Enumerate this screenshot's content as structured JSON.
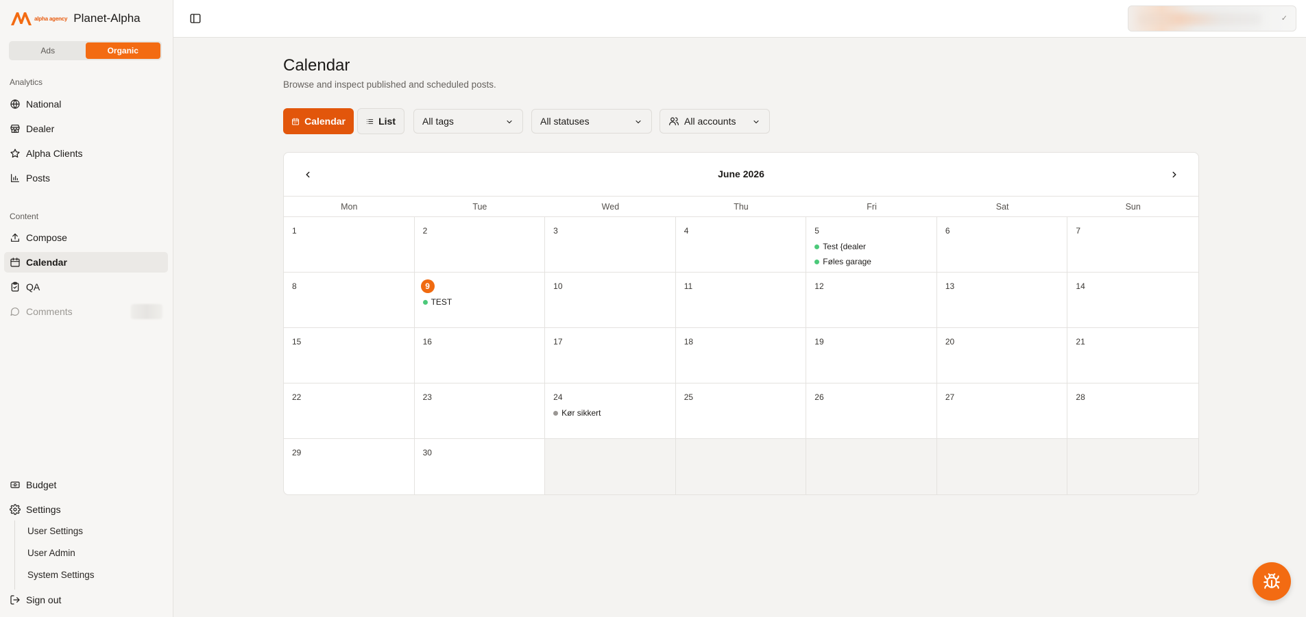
{
  "brand": {
    "agency_text": "alpha agency",
    "name": "Planet-Alpha",
    "accent": "#f36b12"
  },
  "mode": {
    "ads": "Ads",
    "organic": "Organic",
    "selected": "Organic"
  },
  "analytics": {
    "label": "Analytics",
    "items": [
      {
        "label": "National",
        "icon": "globe-icon"
      },
      {
        "label": "Dealer",
        "icon": "store-icon"
      },
      {
        "label": "Alpha Clients",
        "icon": "star-icon"
      },
      {
        "label": "Posts",
        "icon": "bar-chart-icon"
      }
    ]
  },
  "content": {
    "label": "Content",
    "items": [
      {
        "label": "Compose",
        "icon": "upload-icon"
      },
      {
        "label": "Calendar",
        "icon": "calendar-icon",
        "active": true
      },
      {
        "label": "QA",
        "icon": "clipboard-check-icon"
      },
      {
        "label": "Comments",
        "icon": "message-icon",
        "disabled": true
      }
    ]
  },
  "bottom_nav": {
    "budget": "Budget",
    "settings": "Settings",
    "sub": [
      "User Settings",
      "User Admin",
      "System Settings"
    ],
    "sign_out": "Sign out"
  },
  "page": {
    "title": "Calendar",
    "subtitle": "Browse and inspect published and scheduled posts."
  },
  "toolbar": {
    "calendar_btn": "Calendar",
    "list_btn": "List",
    "tags": "All tags",
    "statuses": "All statuses",
    "accounts": "All accounts"
  },
  "calendar": {
    "month_label": "June 2026",
    "weekdays": [
      "Mon",
      "Tue",
      "Wed",
      "Thu",
      "Fri",
      "Sat",
      "Sun"
    ],
    "today": 9,
    "days": [
      {
        "day": 1
      },
      {
        "day": 2
      },
      {
        "day": 3
      },
      {
        "day": 4
      },
      {
        "day": 5,
        "events": [
          {
            "title": "Test {dealer",
            "color": "#4cc97a"
          },
          {
            "title": "Føles garage",
            "color": "#4cc97a"
          }
        ]
      },
      {
        "day": 6
      },
      {
        "day": 7
      },
      {
        "day": 8
      },
      {
        "day": 9,
        "events": [
          {
            "title": "TEST",
            "color": "#4cc97a"
          }
        ]
      },
      {
        "day": 10
      },
      {
        "day": 11
      },
      {
        "day": 12
      },
      {
        "day": 13
      },
      {
        "day": 14
      },
      {
        "day": 15
      },
      {
        "day": 16
      },
      {
        "day": 17
      },
      {
        "day": 18
      },
      {
        "day": 19
      },
      {
        "day": 20
      },
      {
        "day": 21
      },
      {
        "day": 22
      },
      {
        "day": 23
      },
      {
        "day": 24,
        "events": [
          {
            "title": "Kør sikkert",
            "color": "#9a9794"
          }
        ]
      },
      {
        "day": 25
      },
      {
        "day": 26
      },
      {
        "day": 27
      },
      {
        "day": 28
      },
      {
        "day": 29
      },
      {
        "day": 30
      },
      {
        "day": null
      },
      {
        "day": null
      },
      {
        "day": null
      },
      {
        "day": null
      },
      {
        "day": null
      }
    ]
  },
  "fab": {
    "icon": "bug-icon"
  }
}
